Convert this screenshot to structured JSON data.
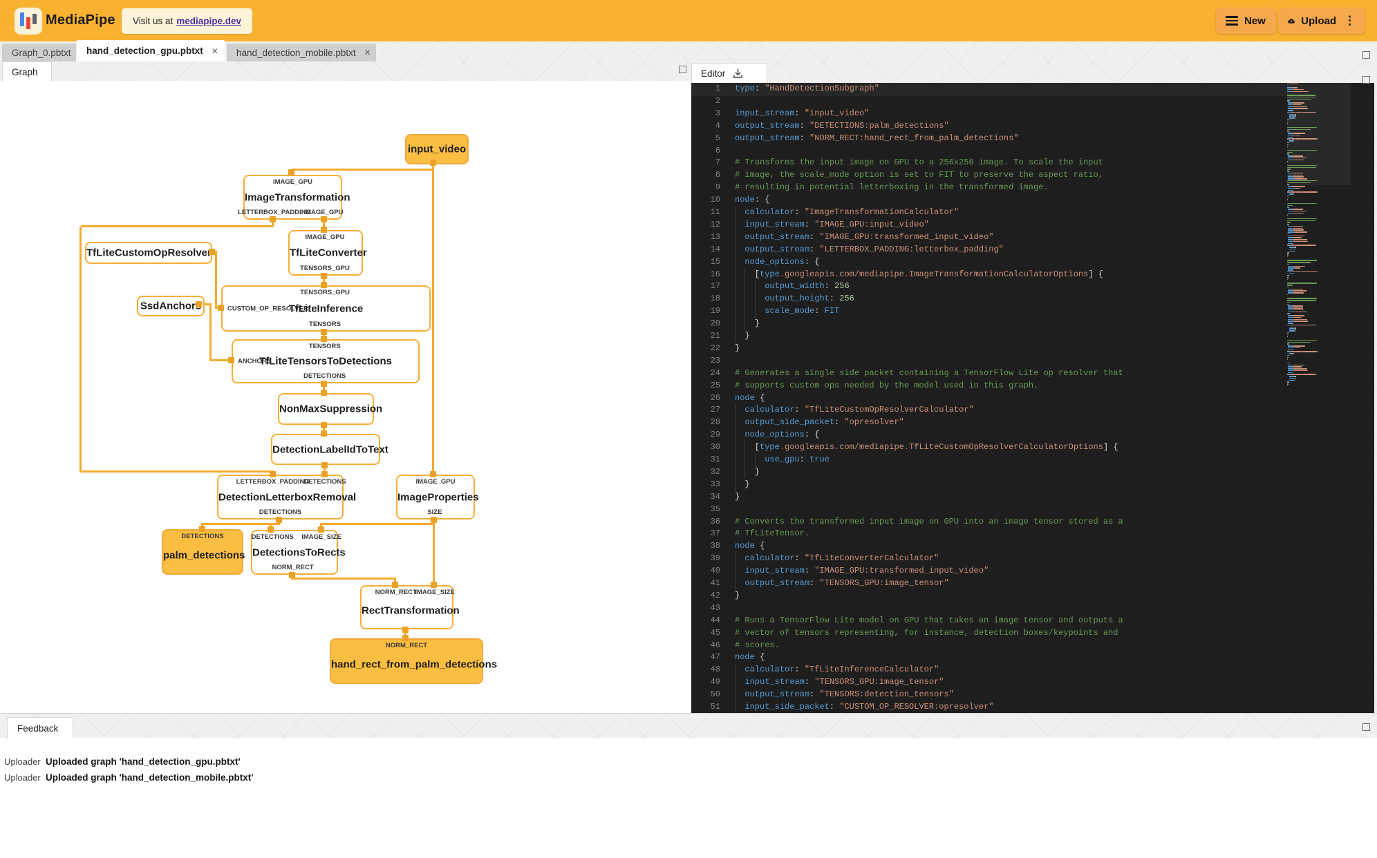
{
  "header": {
    "app_name": "MediaPipe",
    "visit_prefix": "Visit us at",
    "visit_link": "mediapipe.dev",
    "new_label": "New",
    "upload_label": "Upload"
  },
  "file_tabs": [
    {
      "label": "Graph_0.pbtxt",
      "active": false,
      "close": "✕"
    },
    {
      "label": "hand_detection_gpu.pbtxt",
      "active": true,
      "close": "✕"
    },
    {
      "label": "hand_detection_mobile.pbtxt",
      "active": false,
      "close": "✕"
    }
  ],
  "graph_panel": {
    "tab_label": "Graph",
    "nodes": [
      {
        "id": "input_video",
        "label": "input_video",
        "kind": "stream"
      },
      {
        "id": "image_transformation",
        "label": "ImageTransformation",
        "kind": "calculator",
        "top": [
          "IMAGE_GPU"
        ],
        "bottom": [
          "LETTERBOX_PADDING",
          "IMAGE_GPU"
        ]
      },
      {
        "id": "tflite_converter",
        "label": "TfLiteConverter",
        "kind": "calculator",
        "top": [
          "IMAGE_GPU"
        ],
        "bottom": [
          "TENSORS_GPU"
        ]
      },
      {
        "id": "tflite_custom_op_resolver",
        "label": "TfLiteCustomOpResolver",
        "kind": "calculator"
      },
      {
        "id": "ssd_anchors",
        "label": "SsdAnchors",
        "kind": "calculator"
      },
      {
        "id": "tflite_inference",
        "label": "TfLiteInference",
        "kind": "calculator",
        "top": [
          "TENSORS_GPU"
        ],
        "bottom": [
          "TENSORS"
        ],
        "left": [
          "CUSTOM_OP_RESOLVER"
        ]
      },
      {
        "id": "tflite_tensors_to_detections",
        "label": "TfLiteTensorsToDetections",
        "kind": "calculator",
        "top": [
          "TENSORS"
        ],
        "bottom": [
          "DETECTIONS"
        ],
        "left": [
          "ANCHORS"
        ]
      },
      {
        "id": "non_max_suppression",
        "label": "NonMaxSuppression",
        "kind": "calculator"
      },
      {
        "id": "detection_label_id_to_text",
        "label": "DetectionLabelIdToText",
        "kind": "calculator"
      },
      {
        "id": "detection_letterbox_removal",
        "label": "DetectionLetterboxRemoval",
        "kind": "calculator",
        "top": [
          "LETTERBOX_PADDING",
          "DETECTIONS"
        ],
        "bottom": [
          "DETECTIONS"
        ]
      },
      {
        "id": "image_properties",
        "label": "ImageProperties",
        "kind": "calculator",
        "top": [
          "IMAGE_GPU"
        ],
        "bottom": [
          "SIZE"
        ]
      },
      {
        "id": "palm_detections",
        "label": "palm_detections",
        "kind": "stream",
        "top": [
          "DETECTIONS"
        ]
      },
      {
        "id": "detections_to_rects",
        "label": "DetectionsToRects",
        "kind": "calculator",
        "top": [
          "DETECTIONS",
          "IMAGE_SIZE"
        ],
        "bottom": [
          "NORM_RECT"
        ]
      },
      {
        "id": "rect_transformation",
        "label": "RectTransformation",
        "kind": "calculator",
        "top": [
          "NORM_RECT",
          "IMAGE_SIZE"
        ]
      },
      {
        "id": "hand_rect_from_palm_detections",
        "label": "hand_rect_from_palm_detections",
        "kind": "stream",
        "top": [
          "NORM_RECT"
        ]
      }
    ]
  },
  "editor_panel": {
    "tab_label": "Editor",
    "lines": [
      {
        "cur": true,
        "t": [
          [
            "k",
            "type"
          ],
          [
            "p",
            ": "
          ],
          [
            "s",
            "\"HandDetectionSubgraph\""
          ]
        ]
      },
      {
        "t": []
      },
      {
        "t": [
          [
            "k",
            "input_stream"
          ],
          [
            "p",
            ": "
          ],
          [
            "s",
            "\"input_video\""
          ]
        ]
      },
      {
        "t": [
          [
            "k",
            "output_stream"
          ],
          [
            "p",
            ": "
          ],
          [
            "s",
            "\"DETECTIONS:palm_detections\""
          ]
        ]
      },
      {
        "t": [
          [
            "k",
            "output_stream"
          ],
          [
            "p",
            ": "
          ],
          [
            "s",
            "\"NORM_RECT:hand_rect_from_palm_detections\""
          ]
        ]
      },
      {
        "t": []
      },
      {
        "t": [
          [
            "c",
            "# Transforms the input image on GPU to a 256x256 image. To scale the input"
          ]
        ]
      },
      {
        "t": [
          [
            "c",
            "# image, the scale_mode option is set to FIT to preserve the aspect ratio,"
          ]
        ]
      },
      {
        "t": [
          [
            "c",
            "# resulting in potential letterboxing in the transformed image."
          ]
        ]
      },
      {
        "t": [
          [
            "k",
            "node"
          ],
          [
            "p",
            ": {"
          ]
        ]
      },
      {
        "g": 1,
        "t": [
          [
            "p",
            "  "
          ],
          [
            "k",
            "calculator"
          ],
          [
            "p",
            ": "
          ],
          [
            "s",
            "\"ImageTransformationCalculator\""
          ]
        ]
      },
      {
        "g": 1,
        "t": [
          [
            "p",
            "  "
          ],
          [
            "k",
            "input_stream"
          ],
          [
            "p",
            ": "
          ],
          [
            "s",
            "\"IMAGE_GPU:input_video\""
          ]
        ]
      },
      {
        "g": 1,
        "t": [
          [
            "p",
            "  "
          ],
          [
            "k",
            "output_stream"
          ],
          [
            "p",
            ": "
          ],
          [
            "s",
            "\"IMAGE_GPU:transformed_input_video\""
          ]
        ]
      },
      {
        "g": 1,
        "t": [
          [
            "p",
            "  "
          ],
          [
            "k",
            "output_stream"
          ],
          [
            "p",
            ": "
          ],
          [
            "s",
            "\"LETTERBOX_PADDING:letterbox_padding\""
          ]
        ]
      },
      {
        "g": 1,
        "t": [
          [
            "p",
            "  "
          ],
          [
            "k",
            "node_options"
          ],
          [
            "p",
            ": {"
          ]
        ]
      },
      {
        "g": 2,
        "t": [
          [
            "p",
            "    ["
          ],
          [
            "b",
            "type"
          ],
          [
            "d",
            "."
          ],
          [
            "o",
            "googleapis"
          ],
          [
            "d",
            "."
          ],
          [
            "o",
            "com/mediapipe"
          ],
          [
            "d",
            "."
          ],
          [
            "o",
            "ImageTransformationCalculatorOptions"
          ],
          [
            "p",
            "] {"
          ]
        ]
      },
      {
        "g": 3,
        "t": [
          [
            "p",
            "      "
          ],
          [
            "k",
            "output_width"
          ],
          [
            "p",
            ": "
          ],
          [
            "n",
            "256"
          ]
        ]
      },
      {
        "g": 3,
        "t": [
          [
            "p",
            "      "
          ],
          [
            "k",
            "output_height"
          ],
          [
            "p",
            ": "
          ],
          [
            "n",
            "256"
          ]
        ]
      },
      {
        "g": 3,
        "t": [
          [
            "p",
            "      "
          ],
          [
            "k",
            "scale_mode"
          ],
          [
            "p",
            ": "
          ],
          [
            "b",
            "FIT"
          ]
        ]
      },
      {
        "g": 2,
        "t": [
          [
            "p",
            "    }"
          ]
        ]
      },
      {
        "g": 1,
        "t": [
          [
            "p",
            "  }"
          ]
        ]
      },
      {
        "t": [
          [
            "p",
            "}"
          ]
        ]
      },
      {
        "t": []
      },
      {
        "t": [
          [
            "c",
            "# Generates a single side packet containing a TensorFlow Lite op resolver that"
          ]
        ]
      },
      {
        "t": [
          [
            "c",
            "# supports custom ops needed by the model used in this graph."
          ]
        ]
      },
      {
        "t": [
          [
            "k",
            "node"
          ],
          [
            "p",
            " {"
          ]
        ]
      },
      {
        "g": 1,
        "t": [
          [
            "p",
            "  "
          ],
          [
            "k",
            "calculator"
          ],
          [
            "p",
            ": "
          ],
          [
            "s",
            "\"TfLiteCustomOpResolverCalculator\""
          ]
        ]
      },
      {
        "g": 1,
        "t": [
          [
            "p",
            "  "
          ],
          [
            "k",
            "output_side_packet"
          ],
          [
            "p",
            ": "
          ],
          [
            "s",
            "\"opresolver\""
          ]
        ]
      },
      {
        "g": 1,
        "t": [
          [
            "p",
            "  "
          ],
          [
            "k",
            "node_options"
          ],
          [
            "p",
            ": {"
          ]
        ]
      },
      {
        "g": 2,
        "t": [
          [
            "p",
            "    ["
          ],
          [
            "b",
            "type"
          ],
          [
            "d",
            "."
          ],
          [
            "o",
            "googleapis"
          ],
          [
            "d",
            "."
          ],
          [
            "o",
            "com/mediapipe"
          ],
          [
            "d",
            "."
          ],
          [
            "o",
            "TfLiteCustomOpResolverCalculatorOptions"
          ],
          [
            "p",
            "] {"
          ]
        ]
      },
      {
        "g": 3,
        "t": [
          [
            "p",
            "      "
          ],
          [
            "k",
            "use_gpu"
          ],
          [
            "p",
            ": "
          ],
          [
            "b",
            "true"
          ]
        ]
      },
      {
        "g": 2,
        "t": [
          [
            "p",
            "    }"
          ]
        ]
      },
      {
        "g": 1,
        "t": [
          [
            "p",
            "  }"
          ]
        ]
      },
      {
        "t": [
          [
            "p",
            "}"
          ]
        ]
      },
      {
        "t": []
      },
      {
        "t": [
          [
            "c",
            "# Converts the transformed input image on GPU into an image tensor stored as a"
          ]
        ]
      },
      {
        "t": [
          [
            "c",
            "# TfLiteTensor."
          ]
        ]
      },
      {
        "t": [
          [
            "k",
            "node"
          ],
          [
            "p",
            " {"
          ]
        ]
      },
      {
        "g": 1,
        "t": [
          [
            "p",
            "  "
          ],
          [
            "k",
            "calculator"
          ],
          [
            "p",
            ": "
          ],
          [
            "s",
            "\"TfLiteConverterCalculator\""
          ]
        ]
      },
      {
        "g": 1,
        "t": [
          [
            "p",
            "  "
          ],
          [
            "k",
            "input_stream"
          ],
          [
            "p",
            ": "
          ],
          [
            "s",
            "\"IMAGE_GPU:transformed_input_video\""
          ]
        ]
      },
      {
        "g": 1,
        "t": [
          [
            "p",
            "  "
          ],
          [
            "k",
            "output_stream"
          ],
          [
            "p",
            ": "
          ],
          [
            "s",
            "\"TENSORS_GPU:image_tensor\""
          ]
        ]
      },
      {
        "t": [
          [
            "p",
            "}"
          ]
        ]
      },
      {
        "t": []
      },
      {
        "t": [
          [
            "c",
            "# Runs a TensorFlow Lite model on GPU that takes an image tensor and outputs a"
          ]
        ]
      },
      {
        "t": [
          [
            "c",
            "# vector of tensors representing, for instance, detection boxes/keypoints and"
          ]
        ]
      },
      {
        "t": [
          [
            "c",
            "# scores."
          ]
        ]
      },
      {
        "t": [
          [
            "k",
            "node"
          ],
          [
            "p",
            " {"
          ]
        ]
      },
      {
        "g": 1,
        "t": [
          [
            "p",
            "  "
          ],
          [
            "k",
            "calculator"
          ],
          [
            "p",
            ": "
          ],
          [
            "s",
            "\"TfLiteInferenceCalculator\""
          ]
        ]
      },
      {
        "g": 1,
        "t": [
          [
            "p",
            "  "
          ],
          [
            "k",
            "input_stream"
          ],
          [
            "p",
            ": "
          ],
          [
            "s",
            "\"TENSORS_GPU:image_tensor\""
          ]
        ]
      },
      {
        "g": 1,
        "t": [
          [
            "p",
            "  "
          ],
          [
            "k",
            "output_stream"
          ],
          [
            "p",
            ": "
          ],
          [
            "s",
            "\"TENSORS:detection_tensors\""
          ]
        ]
      },
      {
        "g": 1,
        "t": [
          [
            "p",
            "  "
          ],
          [
            "k",
            "input_side_packet"
          ],
          [
            "p",
            ": "
          ],
          [
            "s",
            "\"CUSTOM_OP_RESOLVER:opresolver\""
          ]
        ]
      }
    ]
  },
  "feedback_panel": {
    "tab_label": "Feedback",
    "rows": [
      {
        "source": "Uploader",
        "message": "Uploaded graph 'hand_detection_gpu.pbtxt'"
      },
      {
        "source": "Uploader",
        "message": "Uploaded graph 'hand_detection_mobile.pbtxt'"
      }
    ]
  },
  "colors": {
    "accent": "#F9B130",
    "header_button": "#F5A84C",
    "node_border": "#F6AE35",
    "stream_fill": "#FCBE42",
    "edge": "#F2AC2F",
    "square": "#EBA224",
    "editor_bg": "#1E1E1E",
    "tok_key": "#569CD6",
    "tok_str": "#CE9178",
    "tok_com": "#6A9955",
    "tok_num": "#B5CEA8",
    "tok_dot": "#E05252"
  }
}
